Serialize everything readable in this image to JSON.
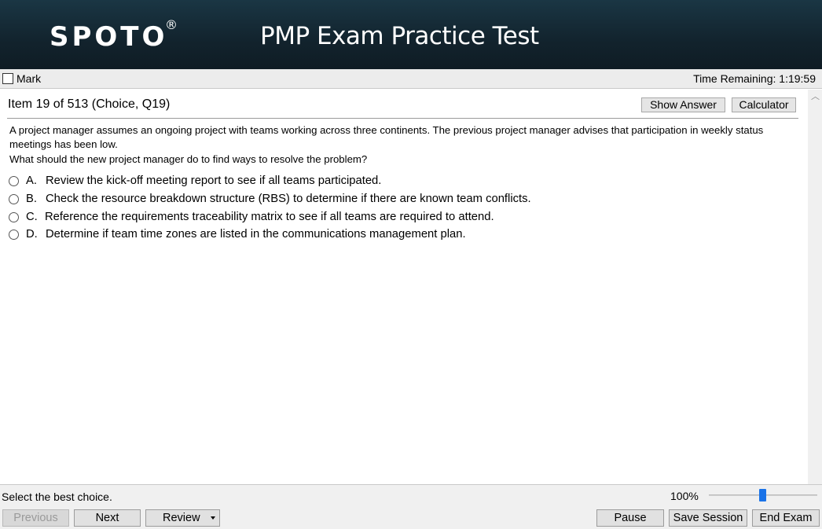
{
  "header": {
    "logo": "SPOTO",
    "logo_mark": "®",
    "title": "PMP Exam Practice Test"
  },
  "markbar": {
    "mark_label": "Mark",
    "mark_checked": false,
    "time_remaining": "Time Remaining: 1:19:59"
  },
  "item": {
    "label": "Item 19 of 513 (Choice, Q19)",
    "show_answer_label": "Show Answer",
    "calculator_label": "Calculator"
  },
  "question": {
    "text": "A project manager assumes an ongoing project with teams working across three continents. The previous project manager advises that participation in weekly status meetings has been low.",
    "prompt": "What should the new project manager do to find ways to resolve the problem?",
    "options": [
      {
        "letter": "A.",
        "text": "Review the kick-off meeting report to see if all teams participated."
      },
      {
        "letter": "B.",
        "text": "Check the resource breakdown structure (RBS) to determine if there are known team conflicts."
      },
      {
        "letter": "C.",
        "text": "Reference the requirements traceability matrix to see if all teams are required to attend."
      },
      {
        "letter": "D.",
        "text": "Determine if team time zones are listed in the communications management plan."
      }
    ]
  },
  "status": {
    "instruction": "Select the best choice.",
    "zoom": "100%"
  },
  "nav": {
    "previous_label": "Previous",
    "next_label": "Next",
    "review_label": "Review",
    "pause_label": "Pause",
    "save_session_label": "Save Session",
    "end_exam_label": "End Exam"
  },
  "colors": {
    "header_bg": "#12232d",
    "slider_thumb": "#1a73e8"
  }
}
